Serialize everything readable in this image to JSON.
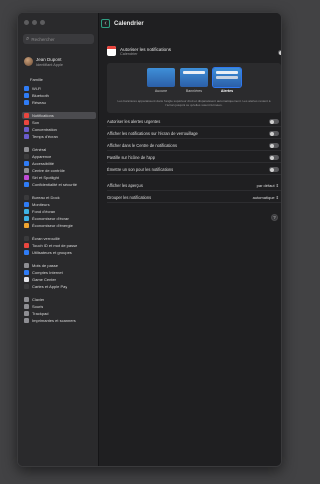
{
  "search": {
    "placeholder": "Rechercher"
  },
  "profile": {
    "name": "Jean Dupont",
    "subtitle": "Identifiant Apple"
  },
  "family": {
    "label": "Famille"
  },
  "sidebar": {
    "items": [
      {
        "label": "Wi-Fi",
        "color": "#2f7cf6"
      },
      {
        "label": "Bluetooth",
        "color": "#2f7cf6"
      },
      {
        "label": "Réseau",
        "color": "#2f7cf6"
      },
      {
        "label": "Notifications",
        "color": "#e9463f",
        "selected": true
      },
      {
        "label": "Son",
        "color": "#e9463f"
      },
      {
        "label": "Concentration",
        "color": "#6a5ccc"
      },
      {
        "label": "Temps d'écran",
        "color": "#6a5ccc"
      },
      {
        "label": "Général",
        "color": "#8e8e93"
      },
      {
        "label": "Apparence",
        "color": "#3a3a3c"
      },
      {
        "label": "Accessibilité",
        "color": "#2f7cf6"
      },
      {
        "label": "Centre de contrôle",
        "color": "#8e8e93"
      },
      {
        "label": "Siri et Spotlight",
        "color": "#c04bd6"
      },
      {
        "label": "Confidentialité et sécurité",
        "color": "#2f7cf6"
      },
      {
        "label": "Bureau et Dock",
        "color": "#3a3a3c"
      },
      {
        "label": "Moniteurs",
        "color": "#2f7cf6"
      },
      {
        "label": "Fond d'écran",
        "color": "#3eb3e6"
      },
      {
        "label": "Économiseur d'écran",
        "color": "#3eb3e6"
      },
      {
        "label": "Économiseur d'énergie",
        "color": "#f0a42f"
      },
      {
        "label": "Écran verrouillé",
        "color": "#3a3a3c"
      },
      {
        "label": "Touch ID et mot de passe",
        "color": "#e9463f"
      },
      {
        "label": "Utilisateurs et groupes",
        "color": "#2f7cf6"
      },
      {
        "label": "Mots de passe",
        "color": "#8e8e93"
      },
      {
        "label": "Comptes Internet",
        "color": "#2f7cf6"
      },
      {
        "label": "Game Center",
        "color": "#e5e5ea"
      },
      {
        "label": "Cartes et Apple Pay",
        "color": "#3a3a3c"
      },
      {
        "label": "Clavier",
        "color": "#8e8e93"
      },
      {
        "label": "Souris",
        "color": "#8e8e93"
      },
      {
        "label": "Trackpad",
        "color": "#8e8e93"
      },
      {
        "label": "Imprimantes et scanners",
        "color": "#8e8e93"
      }
    ]
  },
  "main": {
    "title": "Calendrier",
    "allow_label": "Autoriser les notifications",
    "app_subtitle": "Calendrier",
    "alert_styles": [
      {
        "label": "Aucune"
      },
      {
        "label": "Bannières"
      },
      {
        "label": "Alertes",
        "selected": true
      }
    ],
    "alert_description": "Les bannières apparaissent dans l'angle supérieur droit et disparaissent automatiquement. Les alertes restent à l'écran jusqu'à ce qu'elles soient fermées.",
    "settings": [
      {
        "label": "Autoriser les alertes urgentes",
        "type": "toggle"
      },
      {
        "label": "Afficher les notifications sur l'écran de verrouillage",
        "type": "toggle"
      },
      {
        "label": "Afficher dans le Centre de notifications",
        "type": "toggle"
      },
      {
        "label": "Pastille sur l'icône de l'app",
        "type": "toggle"
      },
      {
        "label": "Émettre un son pour les notifications",
        "type": "toggle"
      },
      {
        "label": "Afficher les aperçus",
        "type": "popup",
        "value": "par défaut"
      },
      {
        "label": "Grouper les notifications",
        "type": "popup",
        "value": "automatique"
      }
    ],
    "help": "?"
  },
  "colors": {
    "accent": "#2f78f0",
    "focus_ring": "#2f9e82",
    "window_bg": "#1f1f21",
    "sidebar_bg": "#2a2a2c"
  },
  "icons": {
    "back": "chevron-left-icon",
    "search": "magnifier-icon"
  }
}
